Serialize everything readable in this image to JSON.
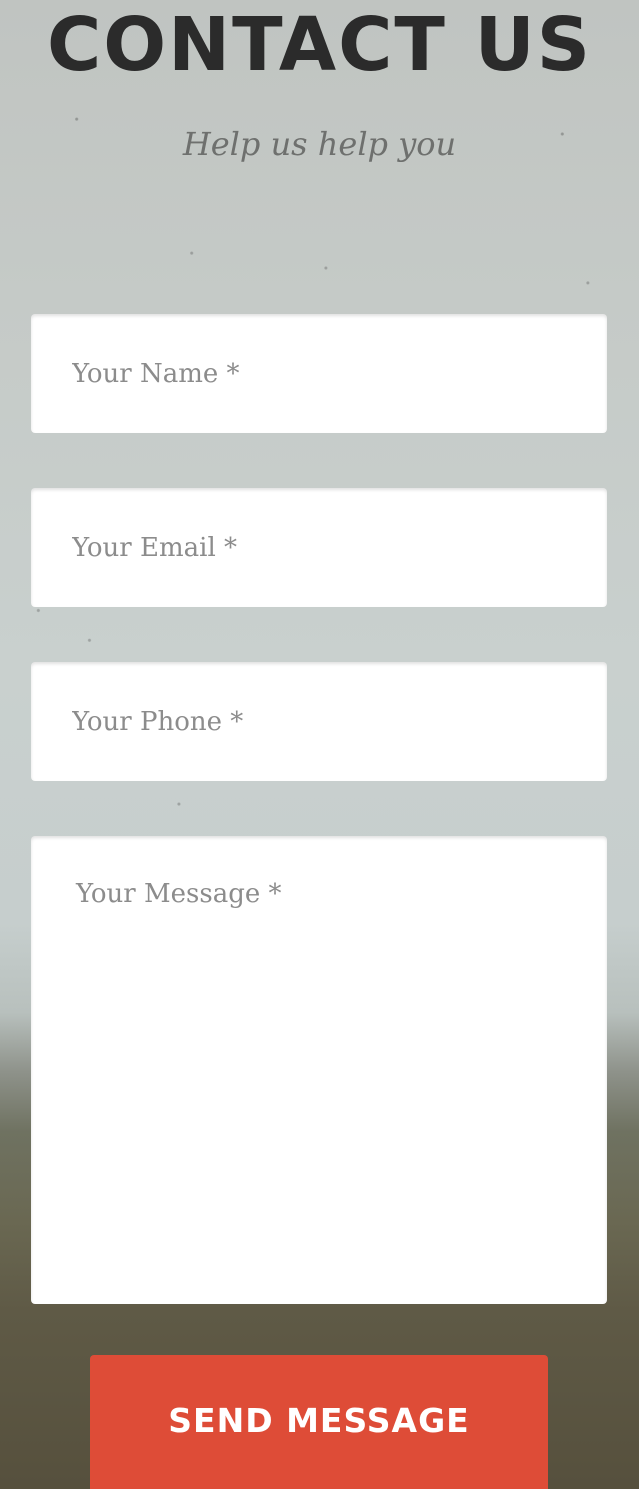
{
  "header": {
    "title": "CONTACT US",
    "subtitle": "Help us help you"
  },
  "form": {
    "name_placeholder": "Your Name *",
    "email_placeholder": "Your Email *",
    "phone_placeholder": "Your Phone *",
    "message_placeholder": "Your Message *",
    "submit_label": "SEND MESSAGE"
  },
  "colors": {
    "accent": "#de4c37",
    "title": "#2b2b2b",
    "subtitle": "#6e706e",
    "placeholder": "#8c8c8c",
    "field_background": "#ffffff"
  }
}
